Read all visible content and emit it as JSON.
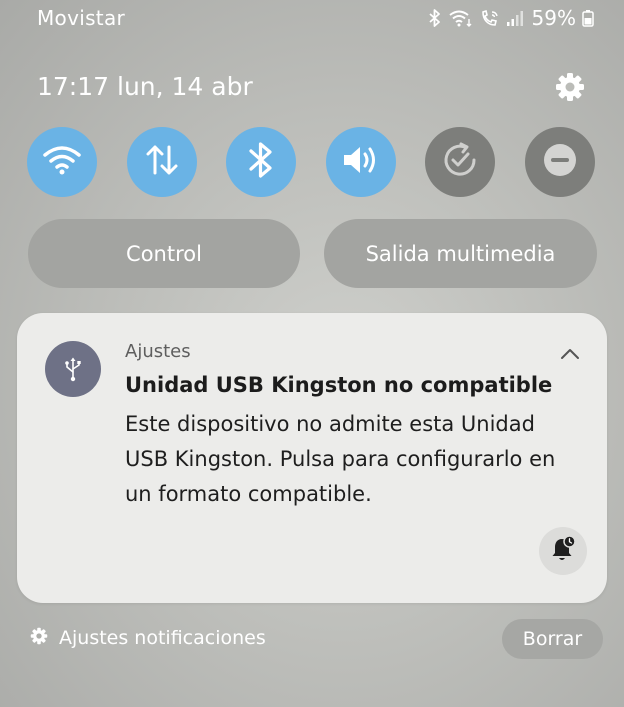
{
  "status_bar": {
    "carrier": "Movistar",
    "battery": "59%",
    "icons": [
      "bluetooth-icon",
      "wifi-icon",
      "wifi-calling-icon",
      "signal-icon",
      "battery-icon"
    ]
  },
  "header": {
    "datetime": "17:17  lun, 14 abr",
    "settings_icon": "gear-icon"
  },
  "quick_toggles": [
    {
      "icon": "wifi-icon",
      "state": "on"
    },
    {
      "icon": "mobile-data-icon",
      "state": "on"
    },
    {
      "icon": "bluetooth-icon",
      "state": "on"
    },
    {
      "icon": "sound-icon",
      "state": "on"
    },
    {
      "icon": "auto-rotate-icon",
      "state": "off"
    },
    {
      "icon": "do-not-disturb-icon",
      "state": "off"
    }
  ],
  "pills": {
    "control": "Control",
    "media_output": "Salida multimedia"
  },
  "notification": {
    "app_name": "Ajustes",
    "title": "Unidad USB Kingston no compatible",
    "body": "Este dispositivo no admite esta Unidad USB Kingston. Pulsa para configurarlo en un formato compatible.",
    "app_icon": "usb-icon",
    "action_icon": "bell-snooze-icon"
  },
  "footer": {
    "settings_label": "Ajustes notificaciones",
    "clear_label": "Borrar"
  },
  "colors": {
    "toggle_on": "#6ab3e5",
    "toggle_off": "#7d7e7b",
    "card_bg": "#ececea"
  }
}
